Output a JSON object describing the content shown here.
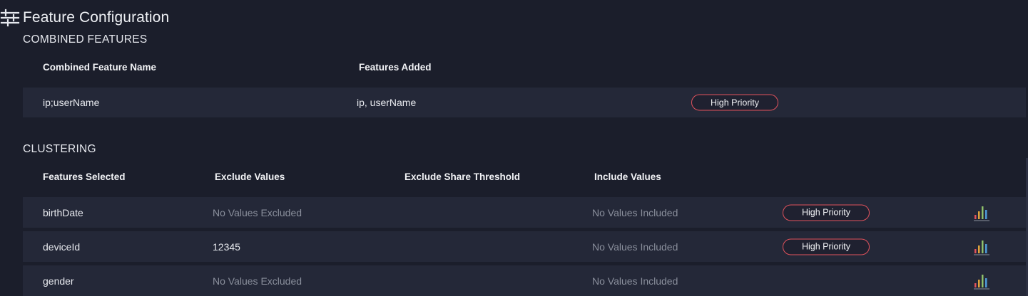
{
  "header": {
    "title": "Feature Configuration",
    "icon": "sliders-icon"
  },
  "combined": {
    "section_title": "COMBINED FEATURES",
    "columns": [
      "Combined Feature Name",
      "Features Added"
    ],
    "rows": [
      {
        "name": "ip;userName",
        "features": "ip, userName",
        "badge": "High Priority"
      }
    ]
  },
  "clustering": {
    "section_title": "CLUSTERING",
    "columns": [
      "Features Selected",
      "Exclude Values",
      "Exclude Share Threshold",
      "Include Values"
    ],
    "rows": [
      {
        "feature": "birthDate",
        "exclude": "No Values Excluded",
        "include": "No Values Included",
        "badge": "High Priority",
        "chart_icon": "bar-chart-icon"
      },
      {
        "feature": "deviceId",
        "exclude": "12345",
        "include": "No Values Included",
        "badge": "High Priority",
        "chart_icon": "bar-chart-icon"
      },
      {
        "feature": "gender",
        "exclude": "No Values Excluded",
        "include": "No Values Included",
        "badge": "",
        "chart_icon": "bar-chart-icon"
      }
    ]
  },
  "colors": {
    "background": "#1b1e2b",
    "row_background": "#242838",
    "badge_border": "#e0525c",
    "muted_text": "#8a8f9c"
  }
}
